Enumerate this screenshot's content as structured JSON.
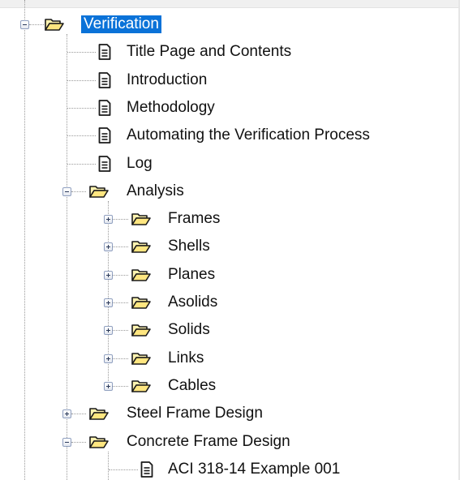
{
  "tree": {
    "root": {
      "label": "Verification",
      "selected": true,
      "expanded": true,
      "icon": "open-folder-icon"
    },
    "root_children": [
      {
        "label": "Title Page and Contents",
        "icon": "document-icon"
      },
      {
        "label": "Introduction",
        "icon": "document-icon"
      },
      {
        "label": "Methodology",
        "icon": "document-icon"
      },
      {
        "label": "Automating the Verification Process",
        "icon": "document-icon"
      },
      {
        "label": "Log",
        "icon": "document-icon"
      },
      {
        "label": "Analysis",
        "icon": "open-folder-icon",
        "expanded": true
      },
      {
        "label": "Steel Frame Design",
        "icon": "open-folder-icon",
        "expanded": false
      },
      {
        "label": "Concrete Frame Design",
        "icon": "open-folder-icon",
        "expanded": true
      }
    ],
    "analysis_children": [
      {
        "label": "Frames",
        "expanded": false
      },
      {
        "label": "Shells",
        "expanded": false
      },
      {
        "label": "Planes",
        "expanded": false
      },
      {
        "label": "Asolids",
        "expanded": false
      },
      {
        "label": "Solids",
        "expanded": false
      },
      {
        "label": "Links",
        "expanded": false
      },
      {
        "label": "Cables",
        "expanded": false
      }
    ],
    "concrete_children": [
      {
        "label": "ACI 318-14 Example 001",
        "icon": "document-icon"
      }
    ]
  },
  "colors": {
    "selection": "#0a72d8",
    "folder_fill": "#ffe680",
    "tree_lines": "#9a9a9a"
  }
}
